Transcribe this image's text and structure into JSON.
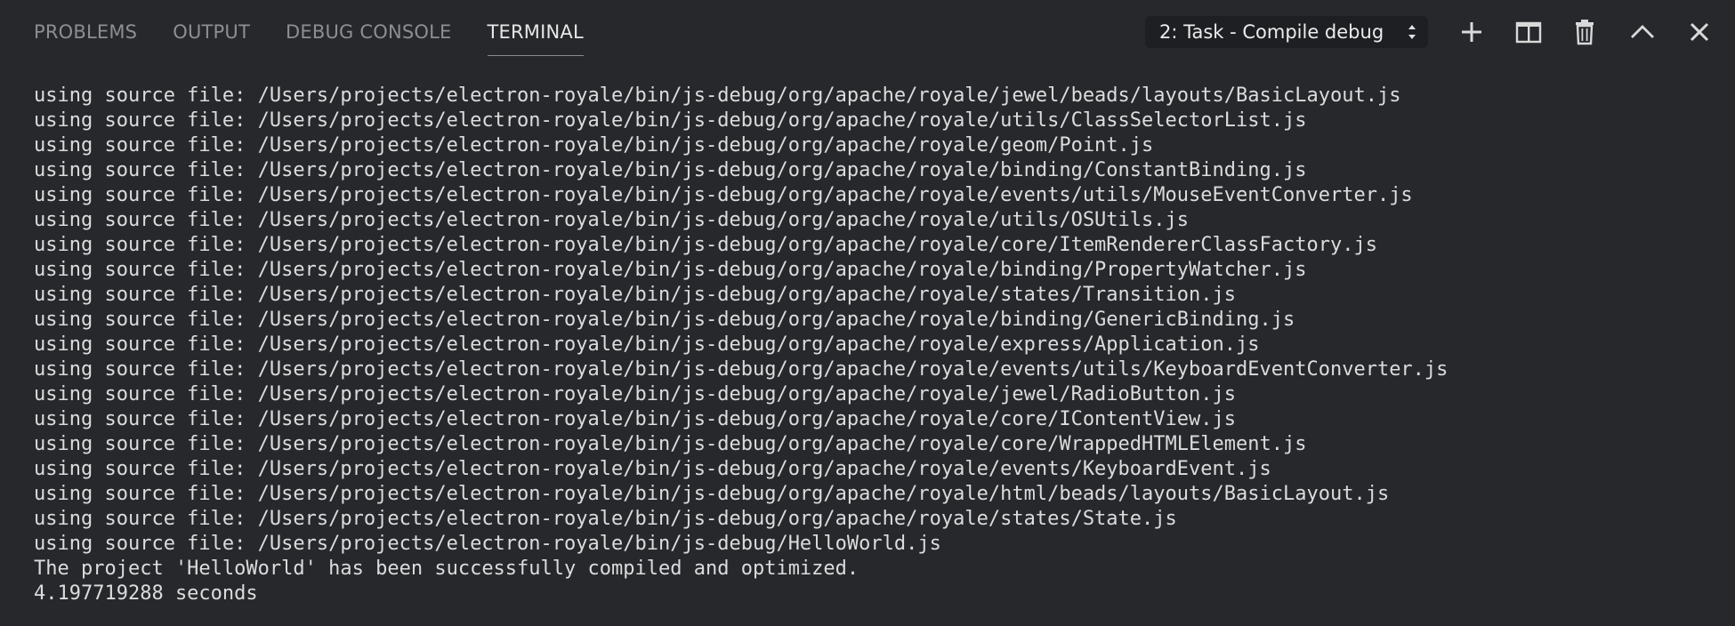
{
  "tabs": [
    {
      "label": "PROBLEMS",
      "active": false
    },
    {
      "label": "OUTPUT",
      "active": false
    },
    {
      "label": "DEBUG CONSOLE",
      "active": false
    },
    {
      "label": "TERMINAL",
      "active": true
    }
  ],
  "task_select": {
    "selected": "2: Task - Compile debug"
  },
  "toolbar_icons": [
    "plus-icon",
    "split-icon",
    "trash-icon",
    "chevron-up-icon",
    "close-icon"
  ],
  "colors": {
    "background": "#27282c",
    "text": "#dcdcdc",
    "tab_inactive": "#8d8e93",
    "tab_active": "#e7e7e7"
  },
  "terminal": {
    "lines": [
      "using source file: /Users/projects/electron-royale/bin/js-debug/org/apache/royale/jewel/beads/layouts/BasicLayout.js",
      "using source file: /Users/projects/electron-royale/bin/js-debug/org/apache/royale/utils/ClassSelectorList.js",
      "using source file: /Users/projects/electron-royale/bin/js-debug/org/apache/royale/geom/Point.js",
      "using source file: /Users/projects/electron-royale/bin/js-debug/org/apache/royale/binding/ConstantBinding.js",
      "using source file: /Users/projects/electron-royale/bin/js-debug/org/apache/royale/events/utils/MouseEventConverter.js",
      "using source file: /Users/projects/electron-royale/bin/js-debug/org/apache/royale/utils/OSUtils.js",
      "using source file: /Users/projects/electron-royale/bin/js-debug/org/apache/royale/core/ItemRendererClassFactory.js",
      "using source file: /Users/projects/electron-royale/bin/js-debug/org/apache/royale/binding/PropertyWatcher.js",
      "using source file: /Users/projects/electron-royale/bin/js-debug/org/apache/royale/states/Transition.js",
      "using source file: /Users/projects/electron-royale/bin/js-debug/org/apache/royale/binding/GenericBinding.js",
      "using source file: /Users/projects/electron-royale/bin/js-debug/org/apache/royale/express/Application.js",
      "using source file: /Users/projects/electron-royale/bin/js-debug/org/apache/royale/events/utils/KeyboardEventConverter.js",
      "using source file: /Users/projects/electron-royale/bin/js-debug/org/apache/royale/jewel/RadioButton.js",
      "using source file: /Users/projects/electron-royale/bin/js-debug/org/apache/royale/core/IContentView.js",
      "using source file: /Users/projects/electron-royale/bin/js-debug/org/apache/royale/core/WrappedHTMLElement.js",
      "using source file: /Users/projects/electron-royale/bin/js-debug/org/apache/royale/events/KeyboardEvent.js",
      "using source file: /Users/projects/electron-royale/bin/js-debug/org/apache/royale/html/beads/layouts/BasicLayout.js",
      "using source file: /Users/projects/electron-royale/bin/js-debug/org/apache/royale/states/State.js",
      "using source file: /Users/projects/electron-royale/bin/js-debug/HelloWorld.js",
      "The project 'HelloWorld' has been successfully compiled and optimized.",
      "4.197719288 seconds"
    ]
  }
}
